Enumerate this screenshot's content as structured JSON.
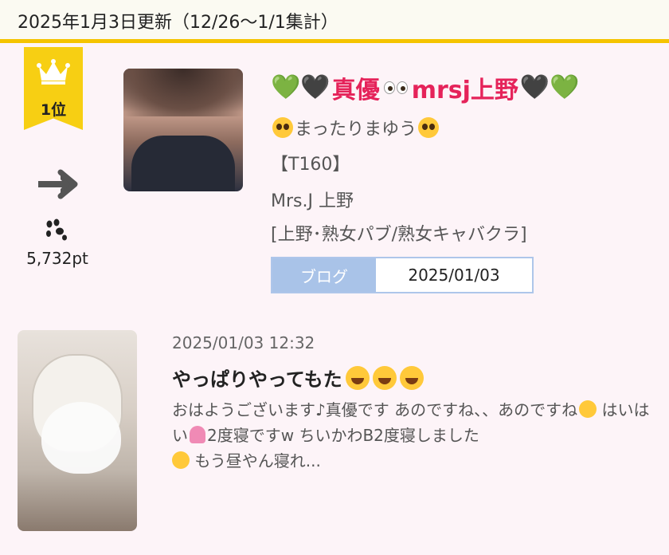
{
  "header": {
    "title": "2025年1月3日更新（12/26〜1/1集計）"
  },
  "ranking": {
    "rank_label": "1位",
    "trend_icon": "arrow-right-icon",
    "points": "5,732pt",
    "colors": {
      "ribbon": "#f7cf13",
      "header_border": "#f5c400"
    }
  },
  "profile": {
    "name": "真優",
    "name_suffix": "mrsj上野",
    "name_color": "#e5235a",
    "heart_left_1": "💚",
    "heart_left_2": "🖤",
    "heart_right_1": "🖤",
    "heart_right_2": "💚",
    "catchphrase": "まったりまゆう",
    "height": "【T160】",
    "shop": "Mrs.J 上野",
    "category": "[上野･熟女パブ/熟女キャバクラ]"
  },
  "blog": {
    "label": "ブログ",
    "date": "2025/01/03",
    "label_bg": "#a9c3e8"
  },
  "post": {
    "timestamp": "2025/01/03 12:32",
    "title": "やっぱりやってもた",
    "body_1": "おはようございます♪真優です あのですね、、あのですね",
    "body_2": " はいはい",
    "body_3": "2度寝ですw ちいかわB2度寝しました",
    "body_4": " もう昼やん寝れ..."
  }
}
